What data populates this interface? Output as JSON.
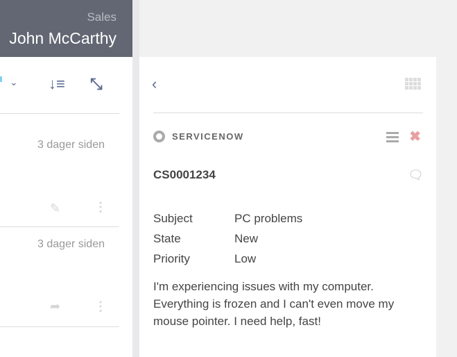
{
  "header": {
    "department": "Sales",
    "name": "John McCarthy"
  },
  "list": {
    "items": [
      {
        "time": "3 dager siden",
        "action_icon": "pencil-icon"
      },
      {
        "time": "3 dager siden",
        "action_icon": "share-icon"
      }
    ]
  },
  "detail": {
    "source": "SERVICENOW",
    "case_id": "CS0001234",
    "fields": [
      {
        "label": "Subject",
        "value": "PC problems"
      },
      {
        "label": "State",
        "value": "New"
      },
      {
        "label": "Priority",
        "value": "Low"
      }
    ],
    "description": "I'm experiencing issues with my computer. Everything is frozen and I can't even move my mouse pointer. I need help, fast!"
  },
  "colors": {
    "header_bg": "#626773",
    "accent": "#5b6b8f",
    "close": "#e8a0a0"
  }
}
